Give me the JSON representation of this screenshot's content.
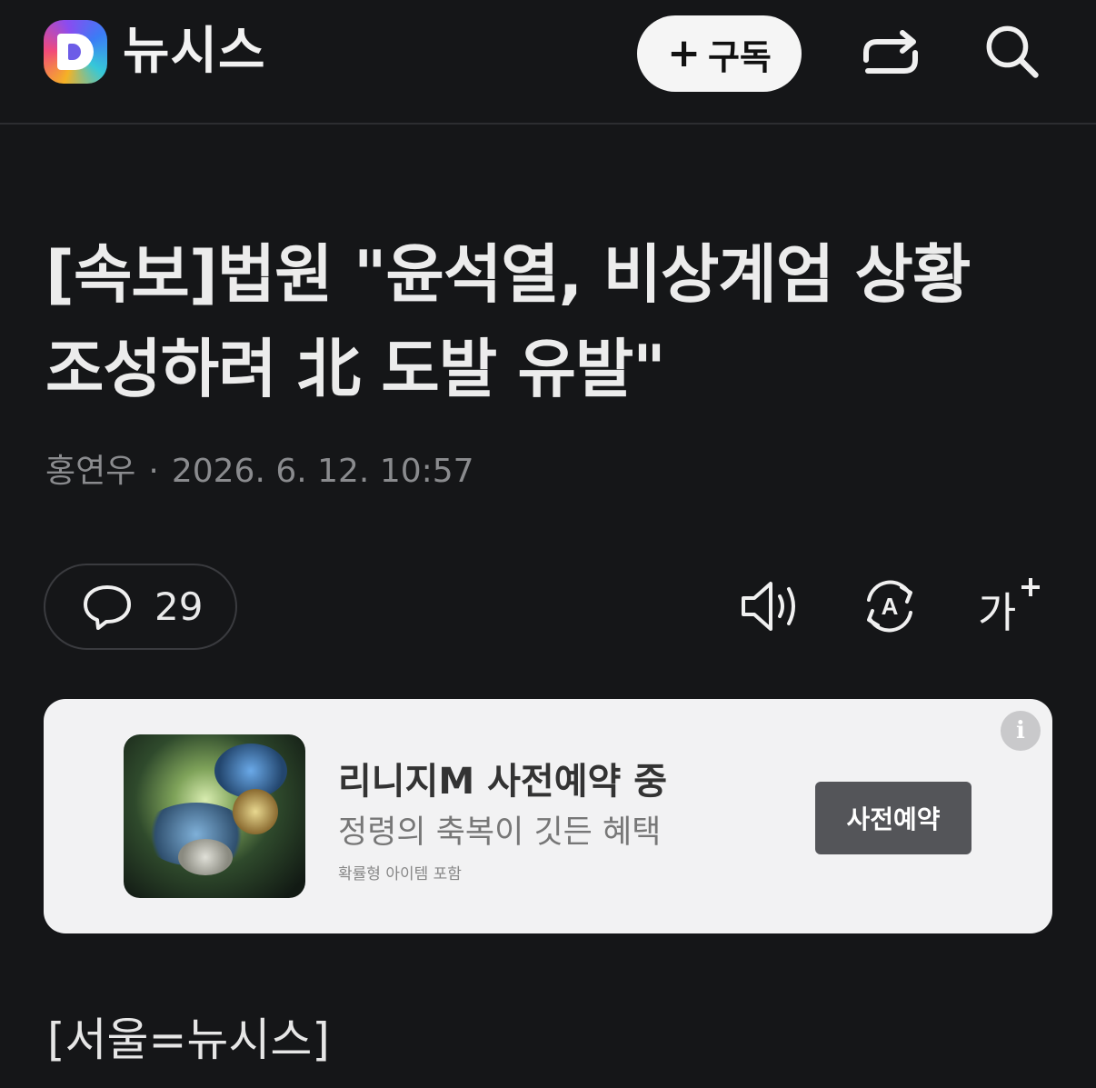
{
  "header": {
    "logo_letter": "D",
    "brand": "뉴시스",
    "subscribe_plus": "+",
    "subscribe_label": "구독",
    "icons": [
      "share-icon",
      "search-icon"
    ]
  },
  "article": {
    "headline_line1": "[속보]법원 \"윤석열, 비상계엄 상황",
    "headline_line2": "조성하려 北 도발 유발\"",
    "author": "홍연우",
    "separator": "·",
    "datetime": "2026. 6. 12. 10:57",
    "comment_count": "29",
    "tools": [
      "speaker-icon",
      "translate-icon",
      "font-size-icon"
    ],
    "font_size_glyph": "가",
    "translate_glyph": "A",
    "dateline": "[서울=뉴시스]"
  },
  "ad": {
    "title": "리니지M 사전예약 중",
    "description": "정령의 축복이 깃든 혜택",
    "note": "확률형 아이템 포함",
    "cta": "사전예약",
    "info_glyph": "i"
  },
  "colors": {
    "background": "#151618",
    "ad_background": "#f2f2f3",
    "cta_background": "#545559"
  }
}
